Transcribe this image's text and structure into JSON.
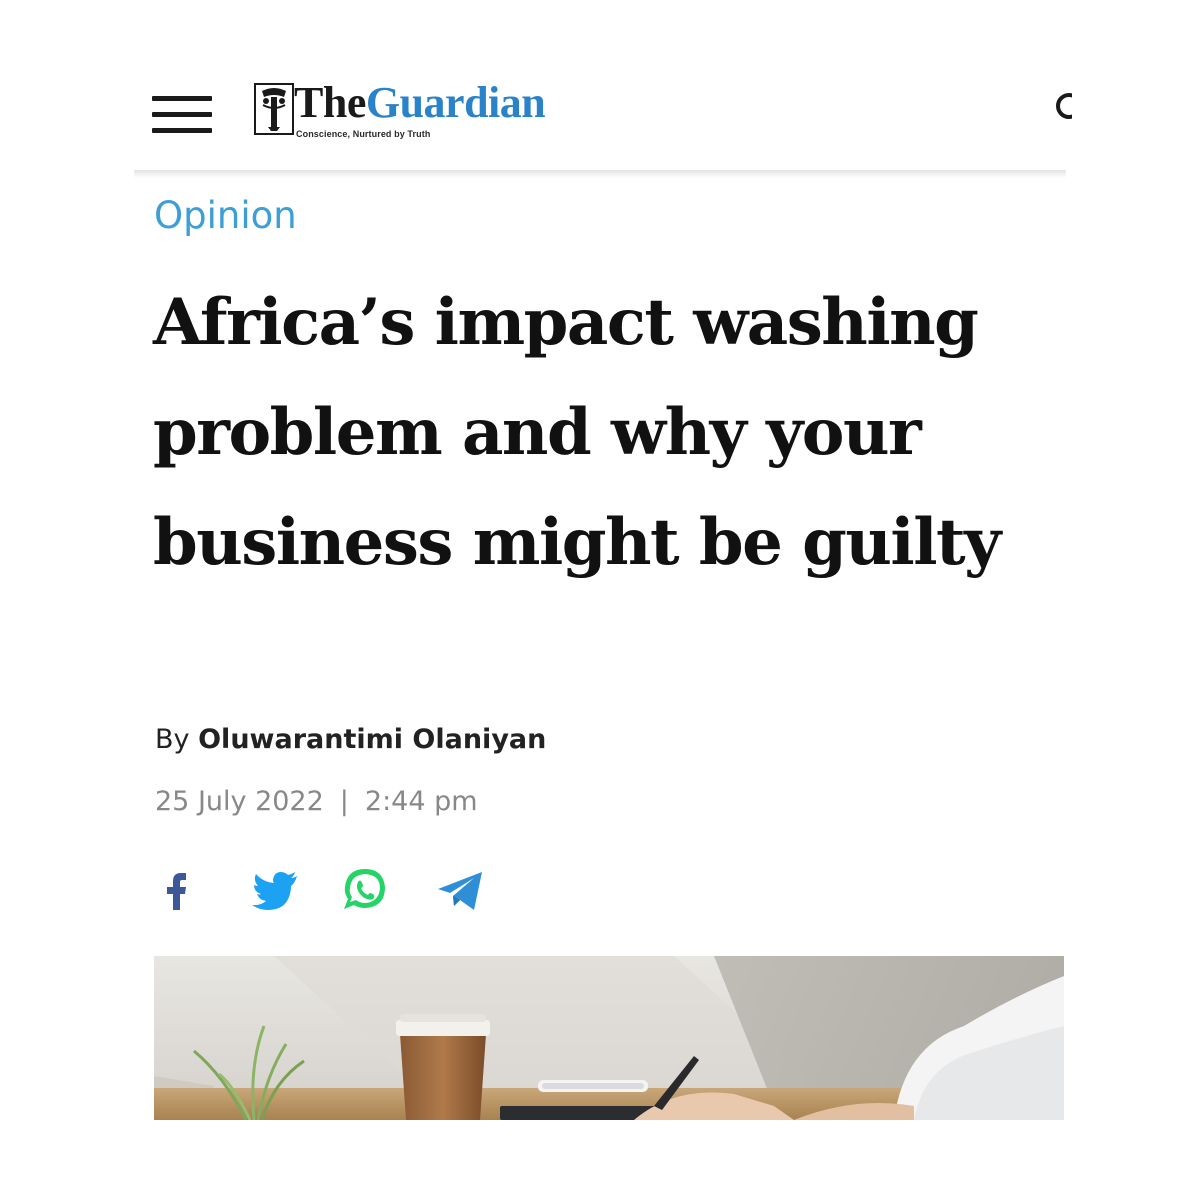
{
  "header": {
    "menu_icon": "hamburger-icon",
    "logo": {
      "the": "The",
      "guardian": "Guardian",
      "tagline": "Conscience, Nurtured by Truth"
    },
    "search_icon": "search-icon"
  },
  "article": {
    "category": "Opinion",
    "headline": "Africa’s impact washing problem and why your business might be guilty",
    "byline_prefix": "By",
    "author": "Oluwarantimi Olaniyan",
    "date": "25 July 2022",
    "separator": "|",
    "time": "2:44 pm"
  },
  "share": [
    {
      "network": "Facebook",
      "icon": "facebook-icon",
      "color": "#3b5998"
    },
    {
      "network": "Twitter",
      "icon": "twitter-icon",
      "color": "#1da1f2"
    },
    {
      "network": "WhatsApp",
      "icon": "whatsapp-icon",
      "color": "#25d366"
    },
    {
      "network": "Telegram",
      "icon": "telegram-icon",
      "color": "#2f8fd6"
    }
  ],
  "colors": {
    "accent": "#2a83c8",
    "category": "#3d9fd6",
    "headline": "#111111",
    "meta": "#888888"
  }
}
